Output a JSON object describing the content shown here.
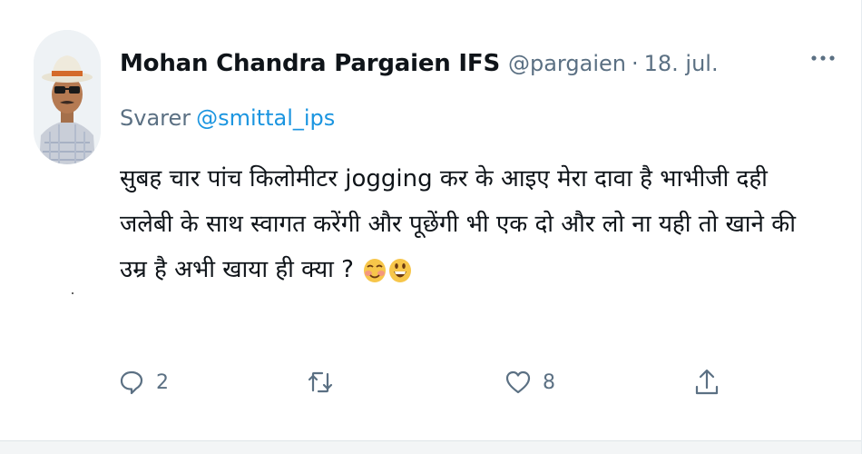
{
  "tweet": {
    "author_name": "Mohan Chandra Pargaien IFS",
    "handle": "@pargaien",
    "separator": "·",
    "date": "18. jul.",
    "reply_prefix": "Svarer",
    "reply_mention": "@smittal_ips",
    "text": "सुबह चार पांच किलोमीटर jogging कर के आइए मेरा दावा है भाभीजी दही जलेबी के साथ स्वागत करेंगी और पूछेंगी भी एक दो और लो ना यही तो खाने की उम्र है अभी खाया ही क्या ?",
    "emojis": [
      "smiling-face-with-smiling-eyes-emoji",
      "grinning-face-emoji"
    ]
  },
  "actions": {
    "reply_count": "2",
    "retweet_count": "",
    "like_count": "8"
  },
  "colors": {
    "text": "#0f1419",
    "secondary": "#5b7083",
    "link": "#1b95e0",
    "border": "#e6ecf0"
  },
  "icons": {
    "more": "more-dots-icon",
    "reply": "reply-icon",
    "retweet": "retweet-icon",
    "like": "like-icon",
    "share": "share-icon"
  }
}
